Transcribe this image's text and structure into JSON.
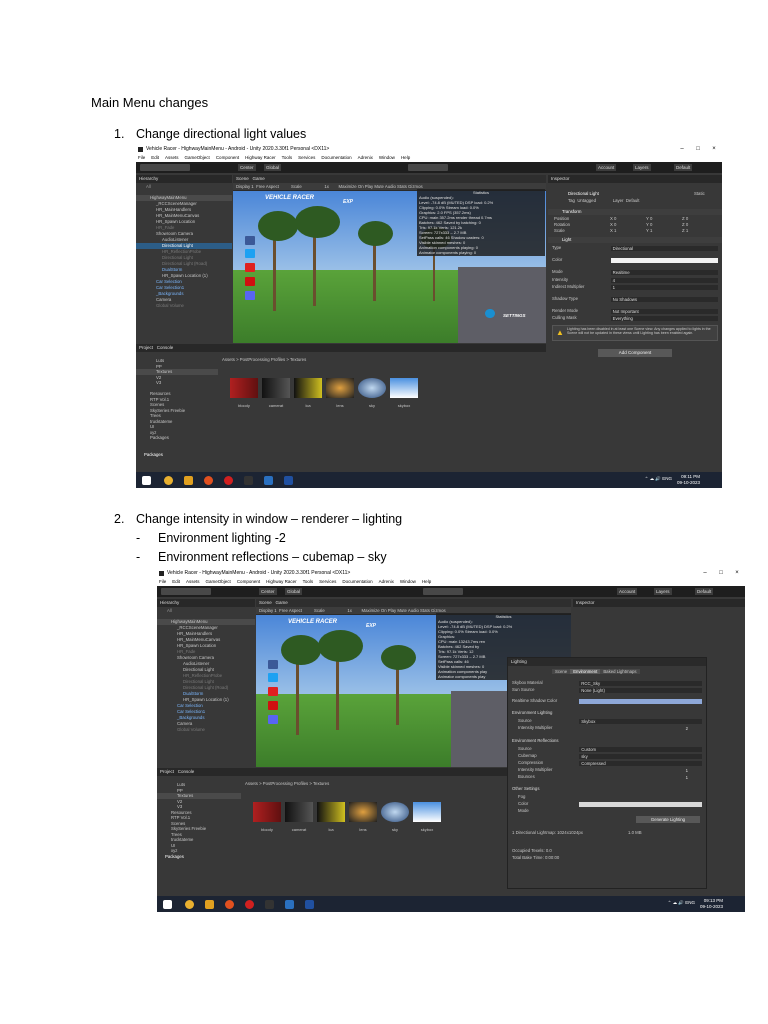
{
  "doc": {
    "heading": "Main Menu changes",
    "item1": {
      "num": "1.",
      "text": "Change directional light values"
    },
    "item2": {
      "num": "2.",
      "text": "Change intensity in window – renderer – lighting"
    },
    "bullets": [
      {
        "dash": "-",
        "text": "Environment lighting -2"
      },
      {
        "dash": "-",
        "text": "Environment reflections – cubemap – sky"
      }
    ]
  },
  "unity": {
    "title": "Vehicle Racer - HighwayMainMenu - Android - Unity 2020.3.30f1 Personal <DX11>",
    "window_controls": [
      "–",
      "□",
      "×"
    ],
    "menu": [
      "File",
      "Edit",
      "Assets",
      "GameObject",
      "Component",
      "Highway Racer",
      "Tools",
      "Services",
      "Documentation",
      "Adrenix",
      "Window",
      "Help"
    ],
    "toolbar": {
      "center": "Center",
      "global": "Global",
      "account": "Account",
      "layers": "Layers",
      "layout": "Default"
    },
    "hierarchy": {
      "tab": "Hierarchy",
      "search": "All",
      "items": [
        "HighwayMainMenu",
        "_RCCSceneManager",
        "HR_MainHandlers",
        "HR_MainMenuCanvas",
        "HR_Spawn Location",
        "HR_Fade",
        "Showroom Camera",
        "AudioListener",
        "Directional Light",
        "HR_ReflectionProbe",
        "Directional Light",
        "Directional Light (Road)",
        "DualStorm",
        "HR_Spawn Location (1)",
        "Car Selection",
        "Car Selection1",
        "_Backgrounds",
        "Camera",
        "Global Volume"
      ]
    },
    "scene": {
      "tab_scene": "Scene",
      "tab_game": "Game",
      "display": "Display 1",
      "aspect": "Free Aspect",
      "scale": "Scale",
      "scale_val": "1x",
      "maximize": "Maximize On Play",
      "mute": "Mute Audio",
      "stats": "Stats",
      "gizmos": "Gizmos"
    },
    "game": {
      "title": "VEHICLE RACER",
      "exp": "EXP",
      "settings": "SETTINGS"
    },
    "stats1": [
      "Statistics",
      "Audio (suspended):",
      "Level: -74.8 dB (MUTED)   DSP load: 0.2%",
      "Clipping: 0.0%   Stream load: 0.0%",
      "Graphics:   2.0 FPS (357.2ms)",
      "CPU: main 357.2ms  render thread 0.7ms",
      "Batches: 462   Saved by batching: 0",
      "Tris: 97.1k   Verts: 121.2k",
      "Screen: 727x333 – 2.7 MB",
      "SetPass calls: 46   Shadow casters: 0",
      "Visible skinned meshes: 0",
      "Animation components playing: 0",
      "Animator components playing: 0"
    ],
    "stats2": [
      "Statistics",
      "Audio (suspended):",
      "Level: -74.8 dB (MUTED)   DSP load: 0.2%",
      "Clipping: 0.0%   Stream load: 0.0%",
      "Graphics:",
      "CPU: main 13243.7ms  ren",
      "Batches: 462   Saved by",
      "Tris: 97.1k   Verts: 12",
      "Screen: 727x333 – 2.7 MB",
      "SetPass calls: 46",
      "Visible skinned meshes: 0",
      "Animation components play",
      "Animator components play"
    ],
    "project": {
      "tab_project": "Project",
      "tab_console": "Console",
      "breadcrumb": "Assets > PostProcessing Profiles > Textures",
      "tree": [
        "Luts",
        "PP",
        "Textures",
        "V2",
        "V3",
        "Resources",
        "RTP Vol.1",
        "Scenes",
        "SkySeries Freebie",
        "Trees",
        "trucktateme",
        "UI",
        "xyz",
        "Packages"
      ],
      "assets": [
        "bloody",
        "camerat",
        "lca",
        "lens",
        "sky",
        "skybox"
      ]
    },
    "inspector": {
      "tab": "Inspector",
      "name": "Directional Light",
      "static": "Static",
      "tag_label": "Tag",
      "tag": "Untagged",
      "layer_label": "Layer",
      "layer": "Default",
      "transform": "Transform",
      "pos": "Position",
      "rot": "Rotation",
      "scale": "Scale",
      "pos_vals": [
        "X 0",
        "Y 0",
        "Z 0"
      ],
      "rot_vals": [
        "X 0",
        "Y 0",
        "Z 0"
      ],
      "scale_vals": [
        "X 1",
        "Y 1",
        "Z 1"
      ],
      "light": "Light",
      "props": [
        [
          "Type",
          "Directional"
        ],
        [
          "Color",
          ""
        ],
        [
          "Mode",
          "Realtime"
        ],
        [
          "Intensity",
          "4"
        ],
        [
          "Indirect Multiplier",
          "1"
        ],
        [
          "Shadow Type",
          "No Shadows"
        ],
        [
          "Render Mode",
          "Not Important"
        ],
        [
          "Culling Mask",
          "Everything"
        ]
      ],
      "warning": "Lighting has been disabled in at least one Scene view. Any changes applied to lights in the Scene will not be updated in these views until Lighting has been enabled again.",
      "add_component": "Add Component"
    },
    "lighting": {
      "tab": "Lighting",
      "tabs": [
        "Scene",
        "Environment",
        "Baked Lightmaps"
      ],
      "rows": [
        [
          "Skybox Material",
          "RCC_Sky"
        ],
        [
          "Sun Source",
          "None (Light)"
        ],
        [
          "Realtime Shadow Color",
          ""
        ]
      ],
      "env_lighting": "Environment Lighting",
      "env_rows": [
        [
          "Source",
          "Skybox"
        ],
        [
          "Intensity Multiplier",
          "2"
        ]
      ],
      "env_refl": "Environment Reflections",
      "refl_rows": [
        [
          "Source",
          "Custom"
        ],
        [
          "Cubemap",
          "sky"
        ],
        [
          "Compression",
          "Compressed"
        ],
        [
          "Intensity Multiplier",
          "1"
        ],
        [
          "Bounces",
          "1"
        ]
      ],
      "other": "Other Settings",
      "fog": "Fog",
      "color": "Color",
      "mode": "Mode",
      "generate": "Generate Lighting",
      "footer": [
        "1 Directional Lightmap: 1024x1024px",
        "1.0 MB",
        "Occupied Texels: 0.0",
        "Total Bake Time: 0:00:00"
      ]
    },
    "taskbar": {
      "lang": "ENG",
      "time1": "09:11 PM",
      "date1": "09-10-2023",
      "time2": "09:13 PM",
      "date2": "09-10-2023"
    }
  }
}
